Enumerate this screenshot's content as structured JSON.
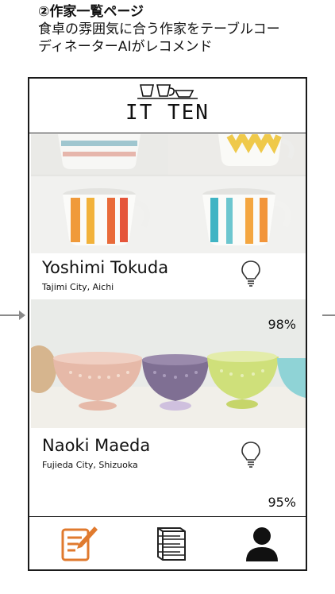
{
  "caption": {
    "title": "②作家一覧ページ",
    "line1": "食卓の雰囲気に合う作家をテーブルコー",
    "line2": "ディネーターAIがレコメンド"
  },
  "app": {
    "logo_text": "IT TEN"
  },
  "artists": [
    {
      "name": "Yoshimi Tokuda",
      "city": "Tajimi City, Aichi",
      "match": "98%"
    },
    {
      "name": "Naoki Maeda",
      "city": "Fujieda City, Shizuoka",
      "match": "95%"
    }
  ],
  "tabs": [
    {
      "icon": "edit-note-icon",
      "color": "#e07a2e"
    },
    {
      "icon": "shelf-icon",
      "color": "#222222"
    },
    {
      "icon": "user-icon",
      "color": "#111111"
    }
  ]
}
